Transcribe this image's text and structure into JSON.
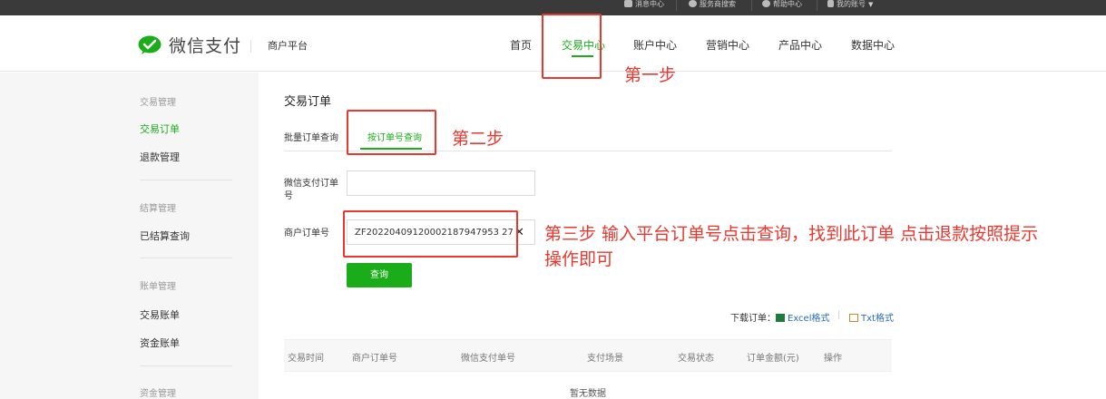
{
  "topbar": {
    "items": [
      "消息中心",
      "服务商搜索",
      "帮助中心",
      "我的账号"
    ]
  },
  "header": {
    "logo_text": "微信支付",
    "logo_sub": "商户平台",
    "nav": [
      "首页",
      "交易中心",
      "账户中心",
      "营销中心",
      "产品中心",
      "数据中心"
    ],
    "active_nav": "交易中心"
  },
  "annotations": {
    "step1": "第一步",
    "step2": "第二步",
    "step3_line1": "第三步 输入平台订单号点击查询，找到此订单 点击退款按照提示",
    "step3_line2": "操作即可",
    "color": "#e8382f"
  },
  "sidebar": {
    "group1": "交易管理",
    "item_orders": "交易订单",
    "item_refund": "退款管理",
    "group2": "结算管理",
    "item_settled": "已结算查询",
    "group3": "账单管理",
    "item_trade_bill": "交易账单",
    "item_fund_bill": "资金账单",
    "group4": "资金管理"
  },
  "main": {
    "title": "交易订单",
    "tabs": [
      "批量订单查询",
      "按订单号查询"
    ],
    "wechat_order_label": "微信支付订单号",
    "wechat_order_value": "",
    "merchant_order_label": "商户订单号",
    "merchant_order_value": "ZF20220409120002187947953 27",
    "query_button": "查询",
    "download_label": "下载订单：",
    "excel": "Excel格式",
    "txt": "Txt格式",
    "table_headers": [
      "交易时间",
      "商户订单号",
      "微信支付单号",
      "支付场景",
      "交易状态",
      "订单金额(元)",
      "操作"
    ],
    "empty_text": "暂无数据"
  },
  "colors": {
    "brand_green": "#1aad19",
    "topbar": "#3a3a3a"
  }
}
